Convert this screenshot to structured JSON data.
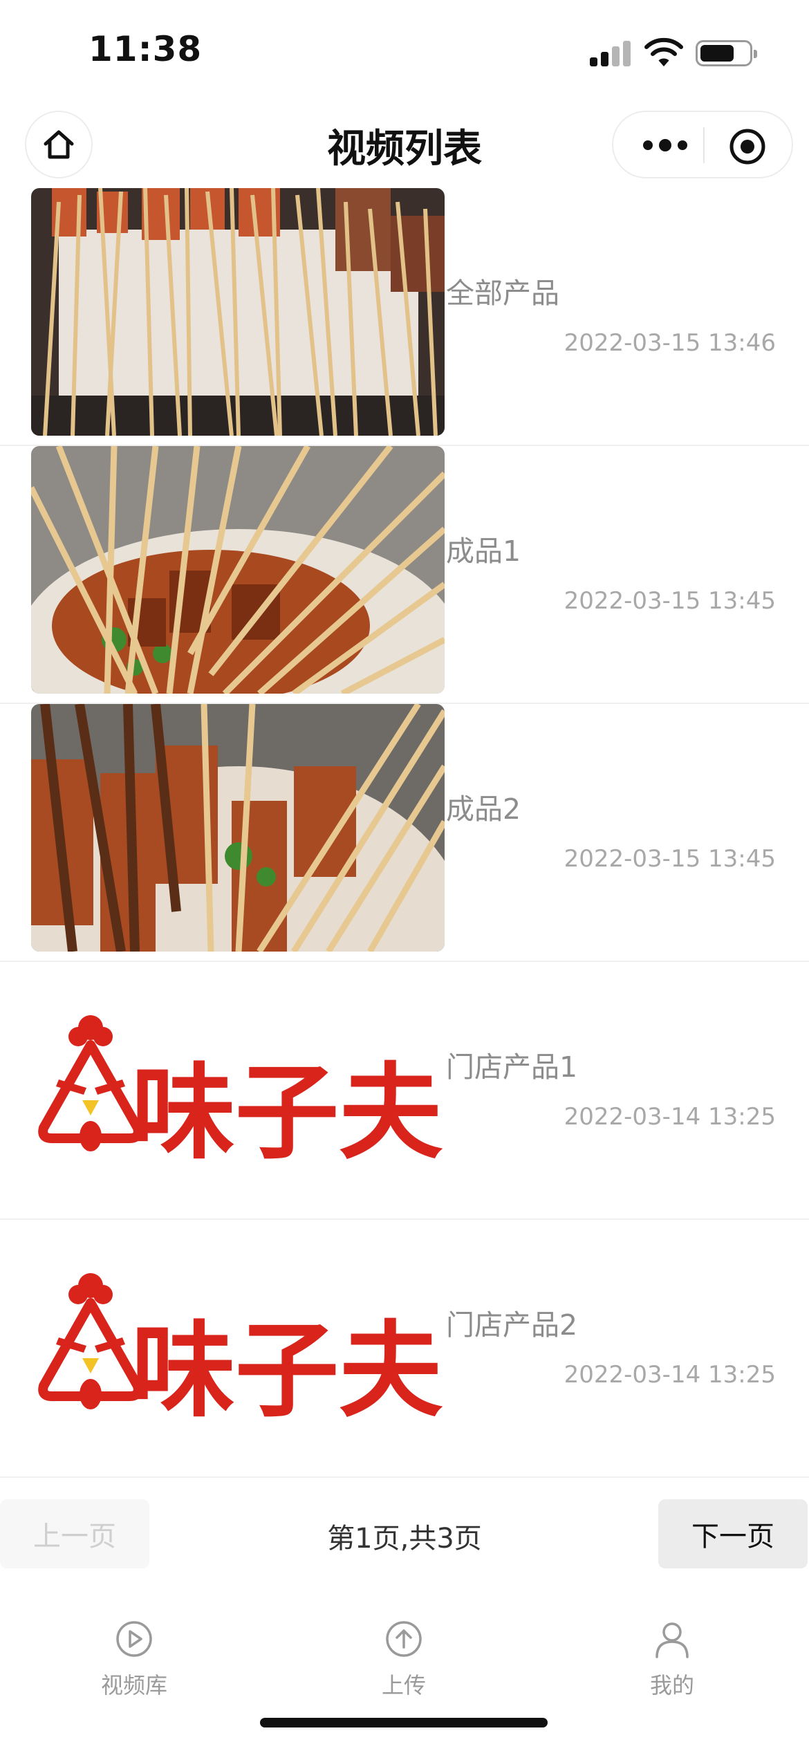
{
  "status_bar": {
    "time": "11:38",
    "battery_level": 0.7
  },
  "nav": {
    "title": "视频列表"
  },
  "videos": [
    {
      "title": "全部产品",
      "date": "2022-03-15 13:46",
      "thumbnail": "skewers-raw-photo"
    },
    {
      "title": "成品1",
      "date": "2022-03-15 13:45",
      "thumbnail": "skewers-cooked-photo"
    },
    {
      "title": "成品2",
      "date": "2022-03-15 13:45",
      "thumbnail": "skewers-closeup-photo"
    },
    {
      "title": "门店产品1",
      "date": "2022-03-14 13:25",
      "thumbnail": "brand-logo",
      "logo_text": "味子夫"
    },
    {
      "title": "门店产品2",
      "date": "2022-03-14 13:25",
      "thumbnail": "brand-logo",
      "logo_text": "味子夫"
    }
  ],
  "pager": {
    "prev_label": "上一页",
    "indicator": "第1页,共3页",
    "next_label": "下一页",
    "current_page": 1,
    "total_pages": 3
  },
  "tabs": [
    {
      "label": "视频库",
      "icon": "play-circle-icon"
    },
    {
      "label": "上传",
      "icon": "upload-arrow-icon"
    },
    {
      "label": "我的",
      "icon": "user-icon"
    }
  ],
  "colors": {
    "brand_red": "#d9241c",
    "beak_yellow": "#f3c326"
  }
}
